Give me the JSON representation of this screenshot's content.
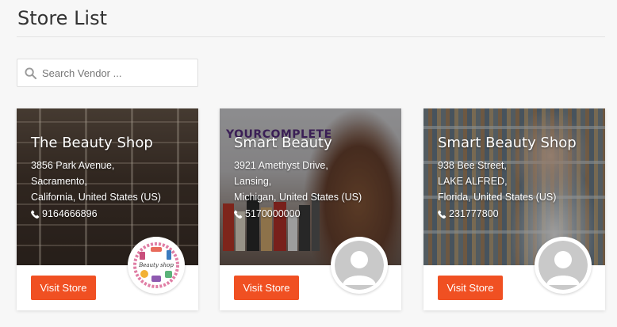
{
  "page": {
    "title": "Store List"
  },
  "search": {
    "placeholder": "Search Vendor ..."
  },
  "stores": [
    {
      "name": "The Beauty Shop",
      "address_line1": "3856 Park Avenue,",
      "address_line2": "Sacramento,",
      "address_line3": "California, United States (US)",
      "phone": "9164666896",
      "button_label": "Visit Store",
      "avatar": "store-logo",
      "logo_text": "Beauty shop"
    },
    {
      "name": "Smart Beauty",
      "address_line1": "3921 Amethyst Drive,",
      "address_line2": "Lansing,",
      "address_line3": "Michigan, United States (US)",
      "phone": "5170000000",
      "button_label": "Visit Store",
      "avatar": "default-user-icon",
      "banner_text": "YOURCOMPLETE"
    },
    {
      "name": "Smart Beauty Shop",
      "address_line1": "938 Bee Street,",
      "address_line2": "LAKE ALFRED,",
      "address_line3": "Florida, United States (US)",
      "phone": "231777800",
      "button_label": "Visit Store",
      "avatar": "default-user-icon"
    }
  ],
  "colors": {
    "accent": "#f05022",
    "background": "#f7f7f7"
  }
}
